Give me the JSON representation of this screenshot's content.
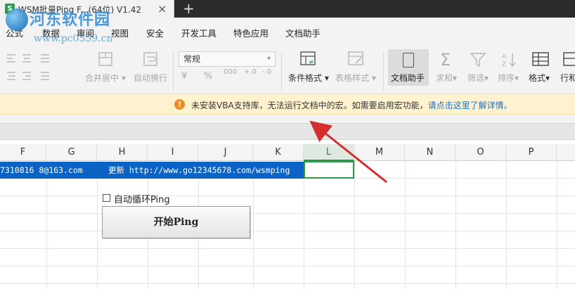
{
  "tab": {
    "icon_letter": "S",
    "title": "WSM批量Ping F...(64位) V1.42",
    "close": "×",
    "new": "+"
  },
  "watermark": {
    "title": "河东软件园",
    "url": "www.pc0359.cn"
  },
  "menu": {
    "items": [
      "公式",
      "数据",
      "审阅",
      "视图",
      "安全",
      "开发工具",
      "特色应用",
      "文档助手"
    ]
  },
  "ribbon": {
    "merge_center": "合并居中",
    "auto_wrap": "自动换行",
    "number_format": "常规",
    "num_symbols": [
      "¥",
      "%",
      "000",
      "+.0",
      "-.0"
    ],
    "conditional_format": "条件格式",
    "table_style": "表格样式",
    "doc_assistant": "文档助手",
    "sum": "求和",
    "filter": "筛选",
    "sort": "排序",
    "format": "格式",
    "rows_cols": "行和"
  },
  "notice": {
    "icon": "!",
    "text": "未安装VBA支持库，无法运行文档中的宏。如需要启用宏功能，",
    "link": "请点击这里了解详情。"
  },
  "columns": [
    "F",
    "G",
    "H",
    "I",
    "J",
    "K",
    "L",
    "M",
    "N",
    "O",
    "P"
  ],
  "selected_column": "L",
  "sheet": {
    "email": "7310816 8@163.com",
    "update": "更新 http://www.go12345678.com/wsmping",
    "checkbox_label": "自动循环Ping",
    "checkbox_checked": false,
    "button_label": "开始Ping"
  },
  "colors": {
    "accent_green": "#2d9a4b",
    "highlight_blue": "#0b63c6",
    "notice_bg": "#fff3cf",
    "arrow_red": "#d32f2f"
  }
}
